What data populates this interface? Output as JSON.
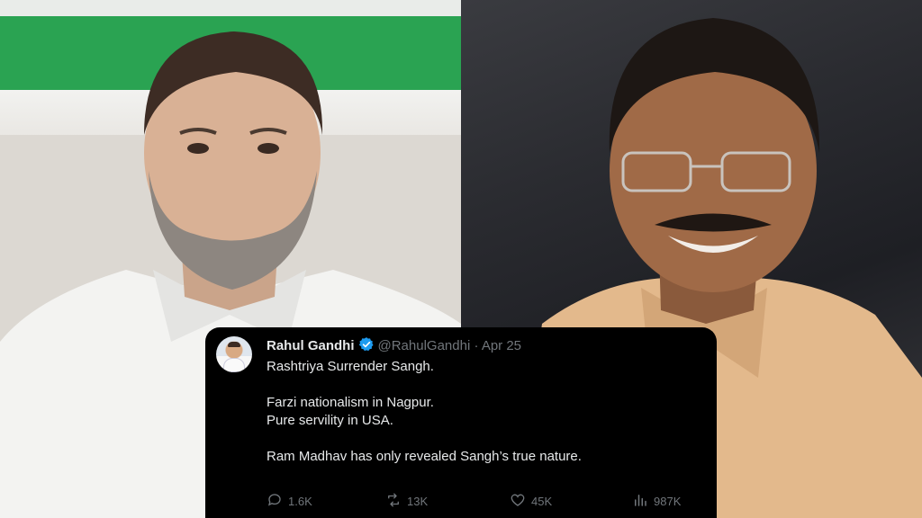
{
  "tweet": {
    "display_name": "Rahul Gandhi",
    "handle": "@RahulGandhi",
    "separator": "·",
    "date": "Apr 25",
    "lines": [
      "Rashtriya Surrender Sangh.",
      "",
      "Farzi nationalism in Nagpur.",
      "Pure servility in USA.",
      "",
      "Ram Madhav has only revealed Sangh’s true nature."
    ],
    "metrics": {
      "replies": "1.6K",
      "reposts": "13K",
      "likes": "45K",
      "views": "987K"
    }
  },
  "colors": {
    "card_bg": "#000000",
    "text_primary": "#e7e9ea",
    "text_secondary": "#71767b",
    "verified_blue": "#1d9bf0"
  },
  "icons": [
    "verified-badge-icon",
    "reply-icon",
    "repost-icon",
    "like-icon",
    "views-icon"
  ]
}
